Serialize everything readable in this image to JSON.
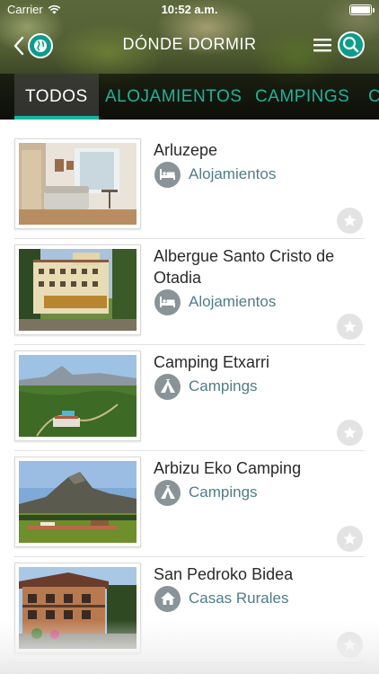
{
  "status_bar": {
    "carrier": "Carrier",
    "time": "10:52 a.m."
  },
  "nav": {
    "title": "DÓNDE DORMIR"
  },
  "tabs": [
    {
      "label": "TODOS"
    },
    {
      "label": "ALOJAMIENTOS"
    },
    {
      "label": "CAMPINGS"
    },
    {
      "label": "C"
    }
  ],
  "items": [
    {
      "title": "Arluzepe",
      "category": "Alojamientos",
      "category_icon": "bed-icon"
    },
    {
      "title": "Albergue Santo Cristo de Otadia",
      "category": "Alojamientos",
      "category_icon": "bed-icon"
    },
    {
      "title": "Camping Etxarri",
      "category": "Campings",
      "category_icon": "tent-icon"
    },
    {
      "title": "Arbizu Eko Camping",
      "category": "Campings",
      "category_icon": "tent-icon"
    },
    {
      "title": "San Pedroko Bidea",
      "category": "Casas Rurales",
      "category_icon": "house-icon"
    }
  ],
  "colors": {
    "accent": "#19b4a0",
    "category_text": "#4f7d86",
    "icon_bg": "#8a9498"
  }
}
